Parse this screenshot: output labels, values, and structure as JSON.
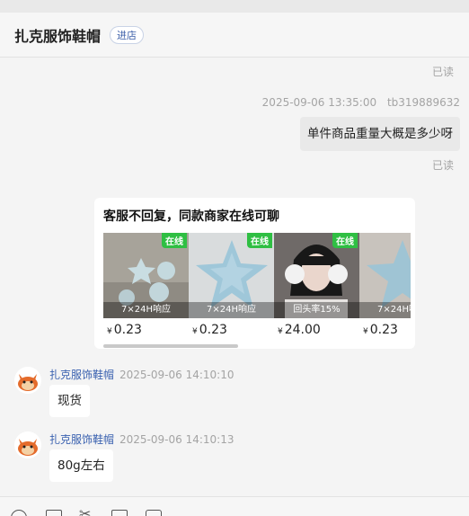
{
  "header": {
    "shop_name": "扎克服饰鞋帽",
    "enter_label": "进店"
  },
  "messages": {
    "read_label_1": "已读",
    "sent_time": "2025-09-06 13:35:00",
    "sender_id": "tb319889632",
    "question": "单件商品重量大概是多少呀",
    "read_label_2": "已读"
  },
  "recommendation": {
    "title": "客服不回复，同款商家在线可聊",
    "items": [
      {
        "tag": "在线",
        "caption": "7×24H响应",
        "currency": "¥",
        "price": "0.23"
      },
      {
        "tag": "在线",
        "caption": "7×24H响应",
        "currency": "¥",
        "price": "0.23"
      },
      {
        "tag": "在线",
        "caption": "回头率15%",
        "currency": "¥",
        "price": "24.00"
      },
      {
        "tag": "在线",
        "caption": "7×24H响应",
        "currency": "¥",
        "price": "0.23"
      }
    ]
  },
  "replies": [
    {
      "name": "扎克服饰鞋帽",
      "time": "2025-09-06 14:10:10",
      "text": "现货"
    },
    {
      "name": "扎克服饰鞋帽",
      "time": "2025-09-06 14:10:13",
      "text": "80g左右"
    }
  ],
  "toolbar": {
    "icons": [
      "emoji-icon",
      "image-icon",
      "scissors-icon",
      "file-icon",
      "chat-icon"
    ]
  },
  "colors": {
    "accent_blue": "#3b62b0",
    "online_green": "#2fbf43",
    "bubble_gray": "#e9e9e9"
  }
}
